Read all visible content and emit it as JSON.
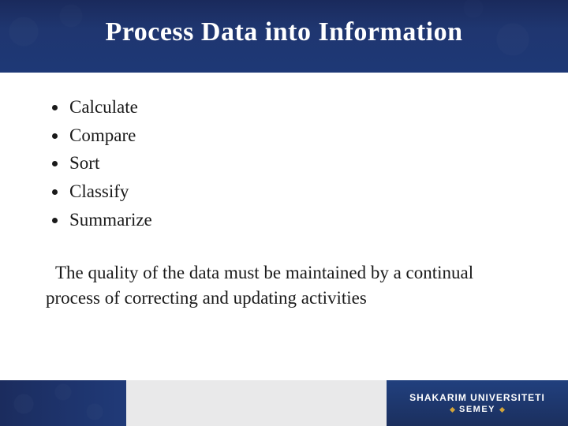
{
  "title": "Process Data into Information",
  "bullets": [
    "Calculate",
    "Compare",
    "Sort",
    "Classify",
    "Summarize"
  ],
  "paragraph": "The quality of the data must be maintained by a continual process of correcting and updating activities",
  "footer": {
    "university_line1": "SHAKARIM UNIVERSITETI",
    "university_line2": "SEMEY"
  }
}
